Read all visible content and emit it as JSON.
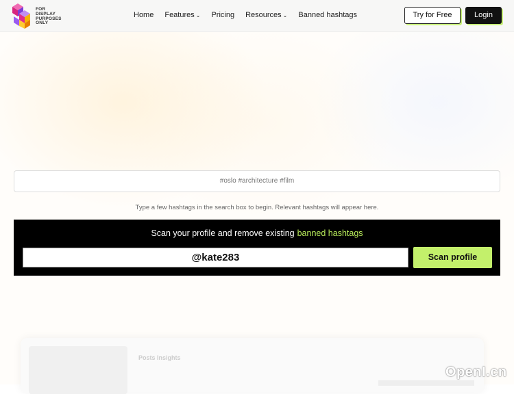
{
  "brand": {
    "logo_lines": [
      "FOR",
      "DISPLAY",
      "PURPOSES",
      "ONLY"
    ],
    "colors": [
      "#e02d8a",
      "#7a3cd6",
      "#f5b400",
      "#1fb6d8"
    ]
  },
  "nav": {
    "links": [
      "Home",
      "Features",
      "Pricing",
      "Resources",
      "Banned hashtags"
    ],
    "try_label": "Try for Free",
    "login_label": "Login"
  },
  "search": {
    "placeholder": "#oslo #architecture #film",
    "helper": "Type a few hashtags in the search box to begin. Relevant hashtags will appear here."
  },
  "scan": {
    "title": "Scan your profile and remove existing",
    "highlight": "banned hashtags",
    "input_value": "@kate283",
    "button_label": "Scan profile"
  },
  "preview": {
    "title": "Posts Insights"
  },
  "watermark": "OpenI.cn",
  "colors": {
    "accent": "#c3f06b",
    "dark": "#000000"
  }
}
